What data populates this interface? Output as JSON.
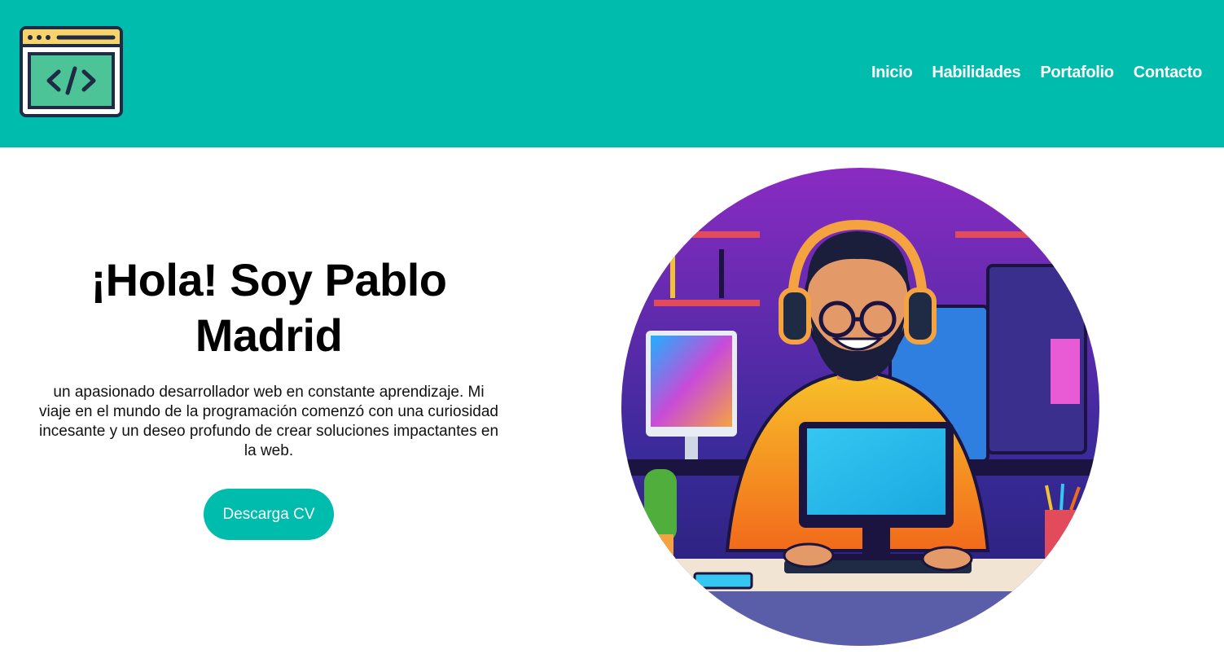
{
  "header": {
    "logo_icon": "code-window-icon",
    "nav": [
      {
        "label": "Inicio"
      },
      {
        "label": "Habilidades"
      },
      {
        "label": "Portafolio"
      },
      {
        "label": "Contacto"
      }
    ]
  },
  "hero": {
    "title_line1": "¡Hola! Soy Pablo",
    "title_line2": "Madrid",
    "description": "un apasionado desarrollador web en constante aprendizaje. Mi viaje en el mundo de la programación comenzó con una curiosidad incesante y un deseo profundo de crear soluciones impactantes en la web.",
    "cv_button": "Descarga CV",
    "illustration": "developer-at-computer-illustration"
  },
  "colors": {
    "brand": "#00bcad",
    "text": "#000000",
    "background": "#ffffff"
  }
}
